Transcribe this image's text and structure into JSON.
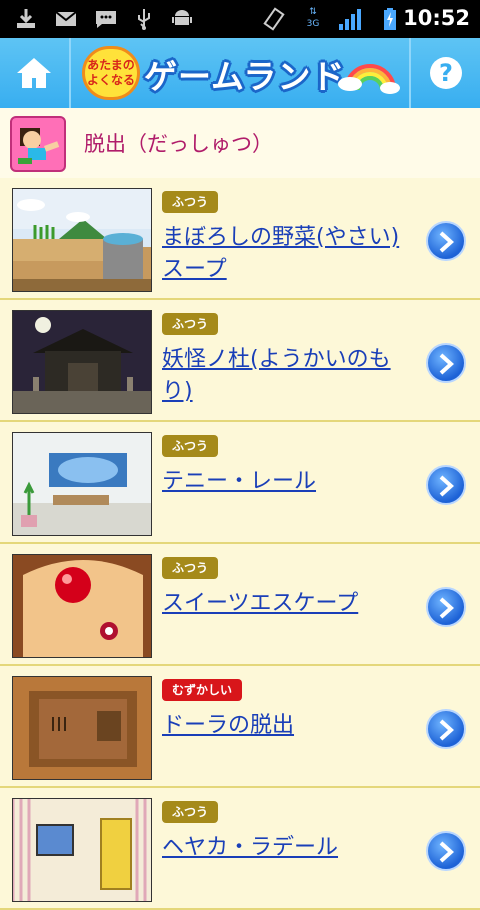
{
  "statusbar": {
    "time": "10:52",
    "network": "3G",
    "icons": [
      "download-icon",
      "mail-icon",
      "chat-icon",
      "usb-icon",
      "android-icon",
      "rotate-icon",
      "signal-icon",
      "battery-charging-icon"
    ]
  },
  "header": {
    "home_icon": "home-icon",
    "logo_sub": "あたまのよくなる",
    "logo_main": "ゲームランド",
    "help_icon": "help-icon"
  },
  "category": {
    "title": "脱出（だっしゅつ）"
  },
  "games": [
    {
      "difficulty": "ふつう",
      "difficulty_color": "#a58a1a",
      "title": "まぼろしの野菜(やさい)スープ"
    },
    {
      "difficulty": "ふつう",
      "difficulty_color": "#a58a1a",
      "title": "妖怪ノ杜(ようかいのもり)"
    },
    {
      "difficulty": "ふつう",
      "difficulty_color": "#a58a1a",
      "title": "テニー・レール"
    },
    {
      "difficulty": "ふつう",
      "difficulty_color": "#a58a1a",
      "title": "スイーツエスケープ"
    },
    {
      "difficulty": "むずかしい",
      "difficulty_color": "#d8161a",
      "title": "ドーラの脱出"
    },
    {
      "difficulty": "ふつう",
      "difficulty_color": "#a58a1a",
      "title": "ヘヤカ・ラデール"
    }
  ],
  "colors": {
    "header": "#38aef0",
    "link": "#1a3fb8",
    "background": "#fdf8d8"
  }
}
